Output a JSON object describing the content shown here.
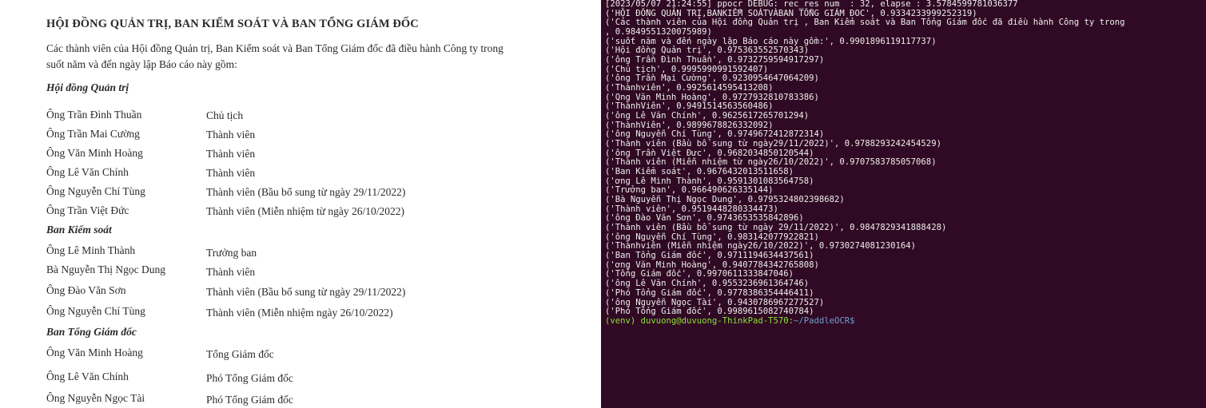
{
  "document": {
    "heading": "HỘI ĐỒNG QUẢN TRỊ, BAN KIỂM SOÁT VÀ BAN TỔNG GIÁM ĐỐC",
    "intro_line1": "Các thành viên của Hội đồng Quản trị, Ban Kiểm soát và Ban Tổng Giám đốc đã điều hành Công ty trong",
    "intro_line2": "suốt năm và đến ngày lập Báo cáo này gồm:",
    "sections": [
      {
        "title": "Hội đồng Quản trị",
        "members": [
          {
            "name": "Ông Trần Đình Thuần",
            "role": "Chủ tịch"
          },
          {
            "name": "Ông Trần Mai Cường",
            "role": "Thành viên"
          },
          {
            "name": "Ông Văn Minh Hoàng",
            "role": "Thành viên"
          },
          {
            "name": "Ông Lê Văn Chính",
            "role": "Thành viên"
          },
          {
            "name": "Ông Nguyễn Chí Tùng",
            "role": "Thành viên (Bầu bổ sung từ ngày 29/11/2022)"
          },
          {
            "name": "Ông Trần Việt Đức",
            "role": "Thành viên (Miễn nhiệm từ ngày 26/10/2022)"
          }
        ]
      },
      {
        "title": "Ban Kiểm soát",
        "members": [
          {
            "name": "Ông Lê Minh Thành",
            "role": "Trưởng ban"
          },
          {
            "name": "Bà Nguyễn Thị Ngọc Dung",
            "role": "Thành viên"
          },
          {
            "name": "Ông Đào Văn Sơn",
            "role": "Thành viên (Bầu bổ sung từ ngày 29/11/2022)"
          },
          {
            "name": "Ông Nguyễn Chí Tùng",
            "role": "Thành viên (Miễn nhiệm ngày 26/10/2022)"
          }
        ]
      },
      {
        "title": "Ban Tổng Giám đốc",
        "members": [
          {
            "name": "Ông Văn Minh Hoàng",
            "role": "Tổng Giám đốc"
          },
          {
            "name": "Ông Lê Văn Chính",
            "role": "Phó Tổng Giám đốc"
          },
          {
            "name": "Ông Nguyễn Ngọc Tài",
            "role": "Phó Tổng Giám đốc"
          }
        ]
      }
    ]
  },
  "terminal": {
    "lines": [
      "[2023/05/07 21:24:55] ppocr DEBUG: rec_res num  : 32, elapse : 3.5784599781036377",
      "('HỘI ĐỒNG QUẢN TRỊ,BANKIỂM SOÁTVÀBAN TỔNG GIÁM ĐOC', 0.9334233999252319)",
      "('Các thành viên của Hội đồng Quản trị , Ban Kiểm soát và Ban Tổng Giám đốc đã điều hành Công ty trong",
      ", 0.9849551320075989)",
      "('suốt năm và đến ngày lập Báo cáo này gồm:', 0.9901896119117737)",
      "('Hội đồng Quản trị', 0.975363552570343)",
      "('ông Trần Đình Thuần', 0.9732759594917297)",
      "('Chủ tịch', 0.9995990991592407)",
      "('ông Trần Mại Cường', 0.9230954647064209)",
      "('Thànhviên', 0.9925614595413208)",
      "('Qng Văn Minh Hoàng', 0.9727932810783386)",
      "('ThànhViên', 0.9491514563560486)",
      "('ông Lê Văn Chính', 0.9625617265701294)",
      "('ThànhViên', 0.9899678826332092)",
      "('ông Nguyễn Chí Tùng', 0.9749672412872314)",
      "('Thành viên (Bầu bổ sung từ ngày29/11/2022)', 0.9788293242454529)",
      "('ông Trần Việt Đưc', 0.9682034850120544)",
      "('Thành viên (Miễn nhiệm từ ngày26/10/2022)', 0.9707583785057068)",
      "('Ban Kiểm soát', 0.9676432013511658)",
      "('ơng Lê Minh Thành', 0.9591301083564758)",
      "('Trưởng ban', 0.966490626335144)",
      "('Bà Nguyễn Thị Ngọc Dung', 0.9795324802398682)",
      "('Thành viên', 0.9519448280334473)",
      "('ông Đào Văn Sơn', 0.9743653535842896)",
      "('Thành viên (Bầu bổ sung từ ngày 29/11/2022)', 0.9847829341888428)",
      "('ông Nguyễn Chí Tùng', 0.983142077922821)",
      "('Thànhviên (Miễn nhiệm ngày26/10/2022)', 0.9730274081230164)",
      "('Ban Tổng Giám đốc', 0.9711194634437561)",
      "('ơng Văn Minh Hoàng', 0.9407784342765808)",
      "('Tổng Giám đốc', 0.9970611333847046)",
      "('ông Lê Văn Chính', 0.9553236961364746)",
      "('Phó Tổng Giám đốc', 0.9778386354446411)",
      "('ông Nguyễn Ngọc Tài', 0.9430786967277527)",
      "('Phó Tổng Giám đốc', 0.9989615082740784)"
    ],
    "prompt_user": "(venv) duvuong@duvuong-ThinkPad-T570:",
    "prompt_path": "~/PaddleOCR$"
  }
}
